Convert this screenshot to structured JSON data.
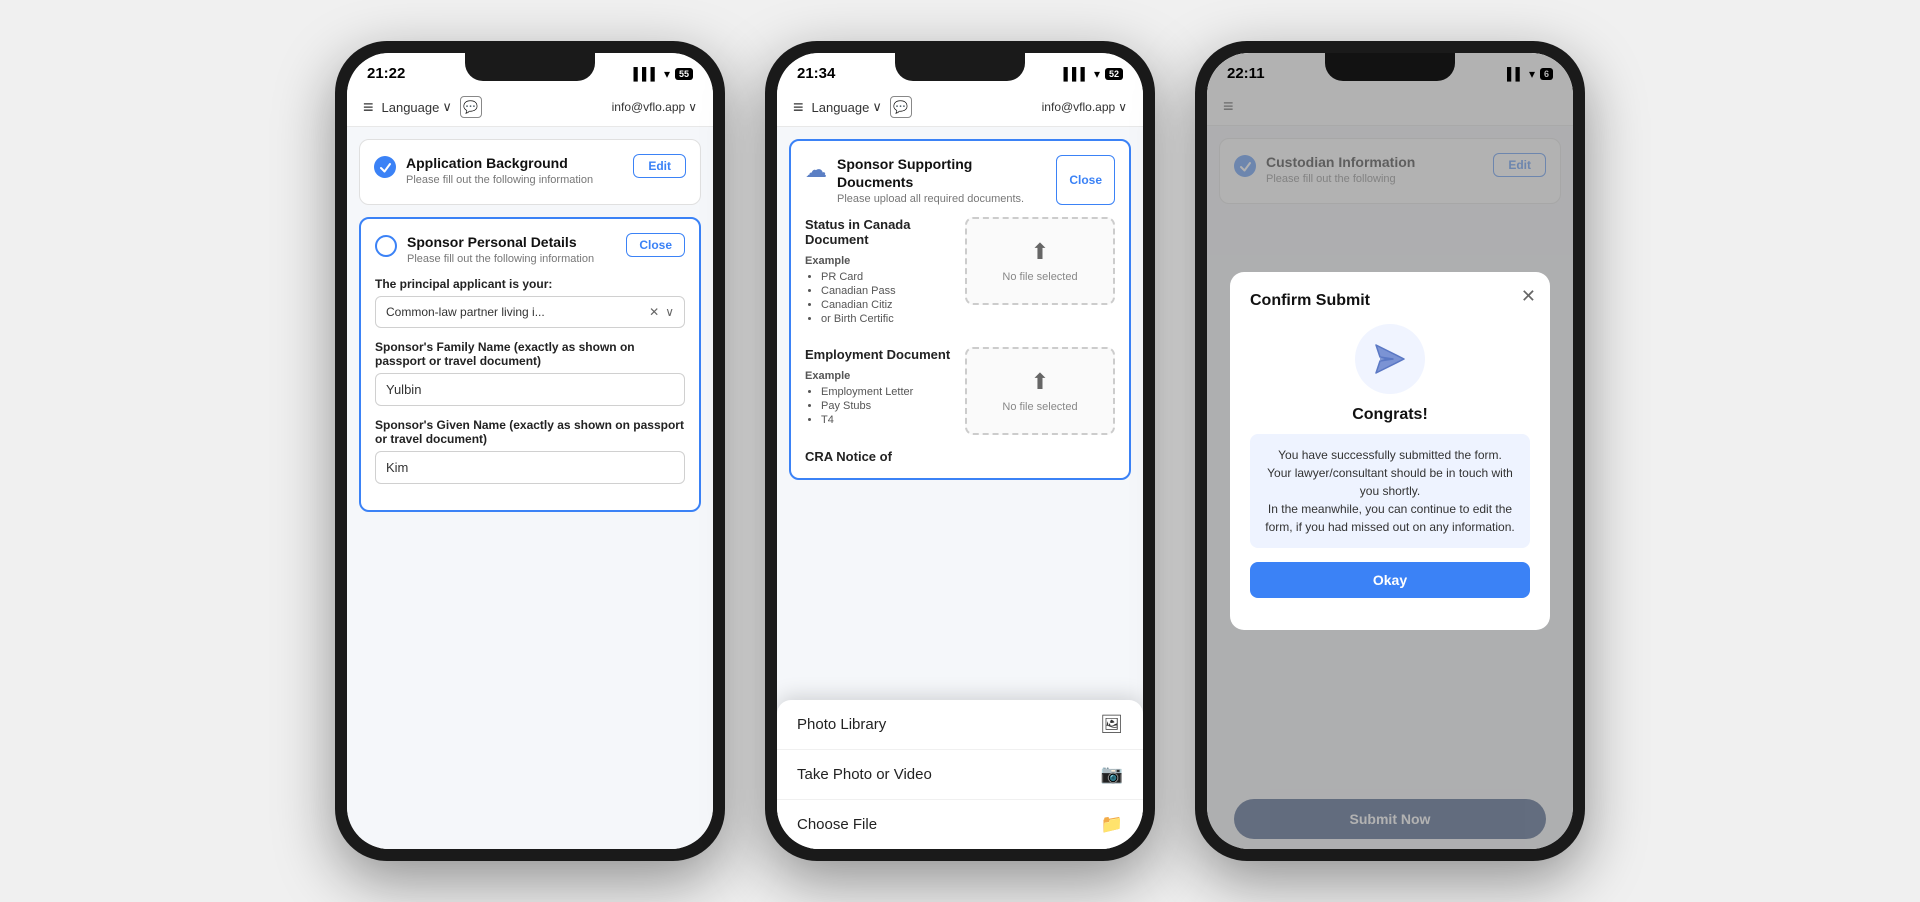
{
  "phone1": {
    "status_time": "21:22",
    "battery": "55",
    "nav": {
      "menu_label": "≡",
      "language_label": "Language",
      "chat_icon": "💬",
      "email": "info@vflo.app"
    },
    "section1": {
      "title": "Application Background",
      "subtitle": "Please fill out the following information",
      "btn": "Edit",
      "completed": true
    },
    "section2": {
      "title": "Sponsor Personal Details",
      "subtitle": "Please fill out the following information",
      "btn": "Close",
      "completed": false,
      "field1_label": "The principal applicant is your:",
      "field1_value": "Common-law partner living i...",
      "field2_label": "Sponsor's Family Name (exactly as shown on passport or travel document)",
      "field2_value": "Yulbin",
      "field3_label": "Sponsor's Given Name (exactly as shown on passport or travel document)",
      "field3_value": "Kim"
    }
  },
  "phone2": {
    "status_time": "21:34",
    "battery": "52",
    "nav": {
      "menu_label": "≡",
      "language_label": "Language",
      "chat_icon": "💬",
      "email": "info@vflo.app"
    },
    "docs_section": {
      "title": "Sponsor Supporting Doucments",
      "subtitle": "Please upload all required documents.",
      "btn": "Close"
    },
    "status_doc": {
      "title": "Status in Canada Document",
      "example_label": "Example",
      "examples": [
        "PR Card",
        "Canadian Pass",
        "Canadian Citiz",
        "or Birth Certific"
      ],
      "upload_text": "No file selected"
    },
    "employment_doc": {
      "title": "Employment Document",
      "example_label": "Example",
      "examples": [
        "Employment Letter",
        "Pay Stubs",
        "T4"
      ],
      "upload_text": "No file selected"
    },
    "cra_doc": {
      "title": "CRA Notice of"
    },
    "action_sheet": {
      "items": [
        {
          "label": "Photo Library",
          "icon": "🖼"
        },
        {
          "label": "Take Photo or Video",
          "icon": "📷"
        },
        {
          "label": "Choose File",
          "icon": "📁"
        }
      ]
    }
  },
  "phone3": {
    "status_time": "22:11",
    "battery": "6",
    "nav": {
      "menu_label": "≡",
      "language_label": "",
      "chat_icon": "",
      "email": ""
    },
    "custodian_section": {
      "title": "Custodian Information",
      "subtitle": "Please fill out the following",
      "btn": "Edit",
      "completed": true
    },
    "modal": {
      "title": "Confirm Submit",
      "close_icon": "✕",
      "congrats_title": "Congrats!",
      "congrats_text": "You have successfully submitted the form.\nYour lawyer/consultant should be in touch with you shortly.\nIn the meanwhile, you can continue to edit the form, if you had missed out on any information.",
      "okay_btn": "Okay"
    },
    "submit_btn": "Submit Now"
  }
}
